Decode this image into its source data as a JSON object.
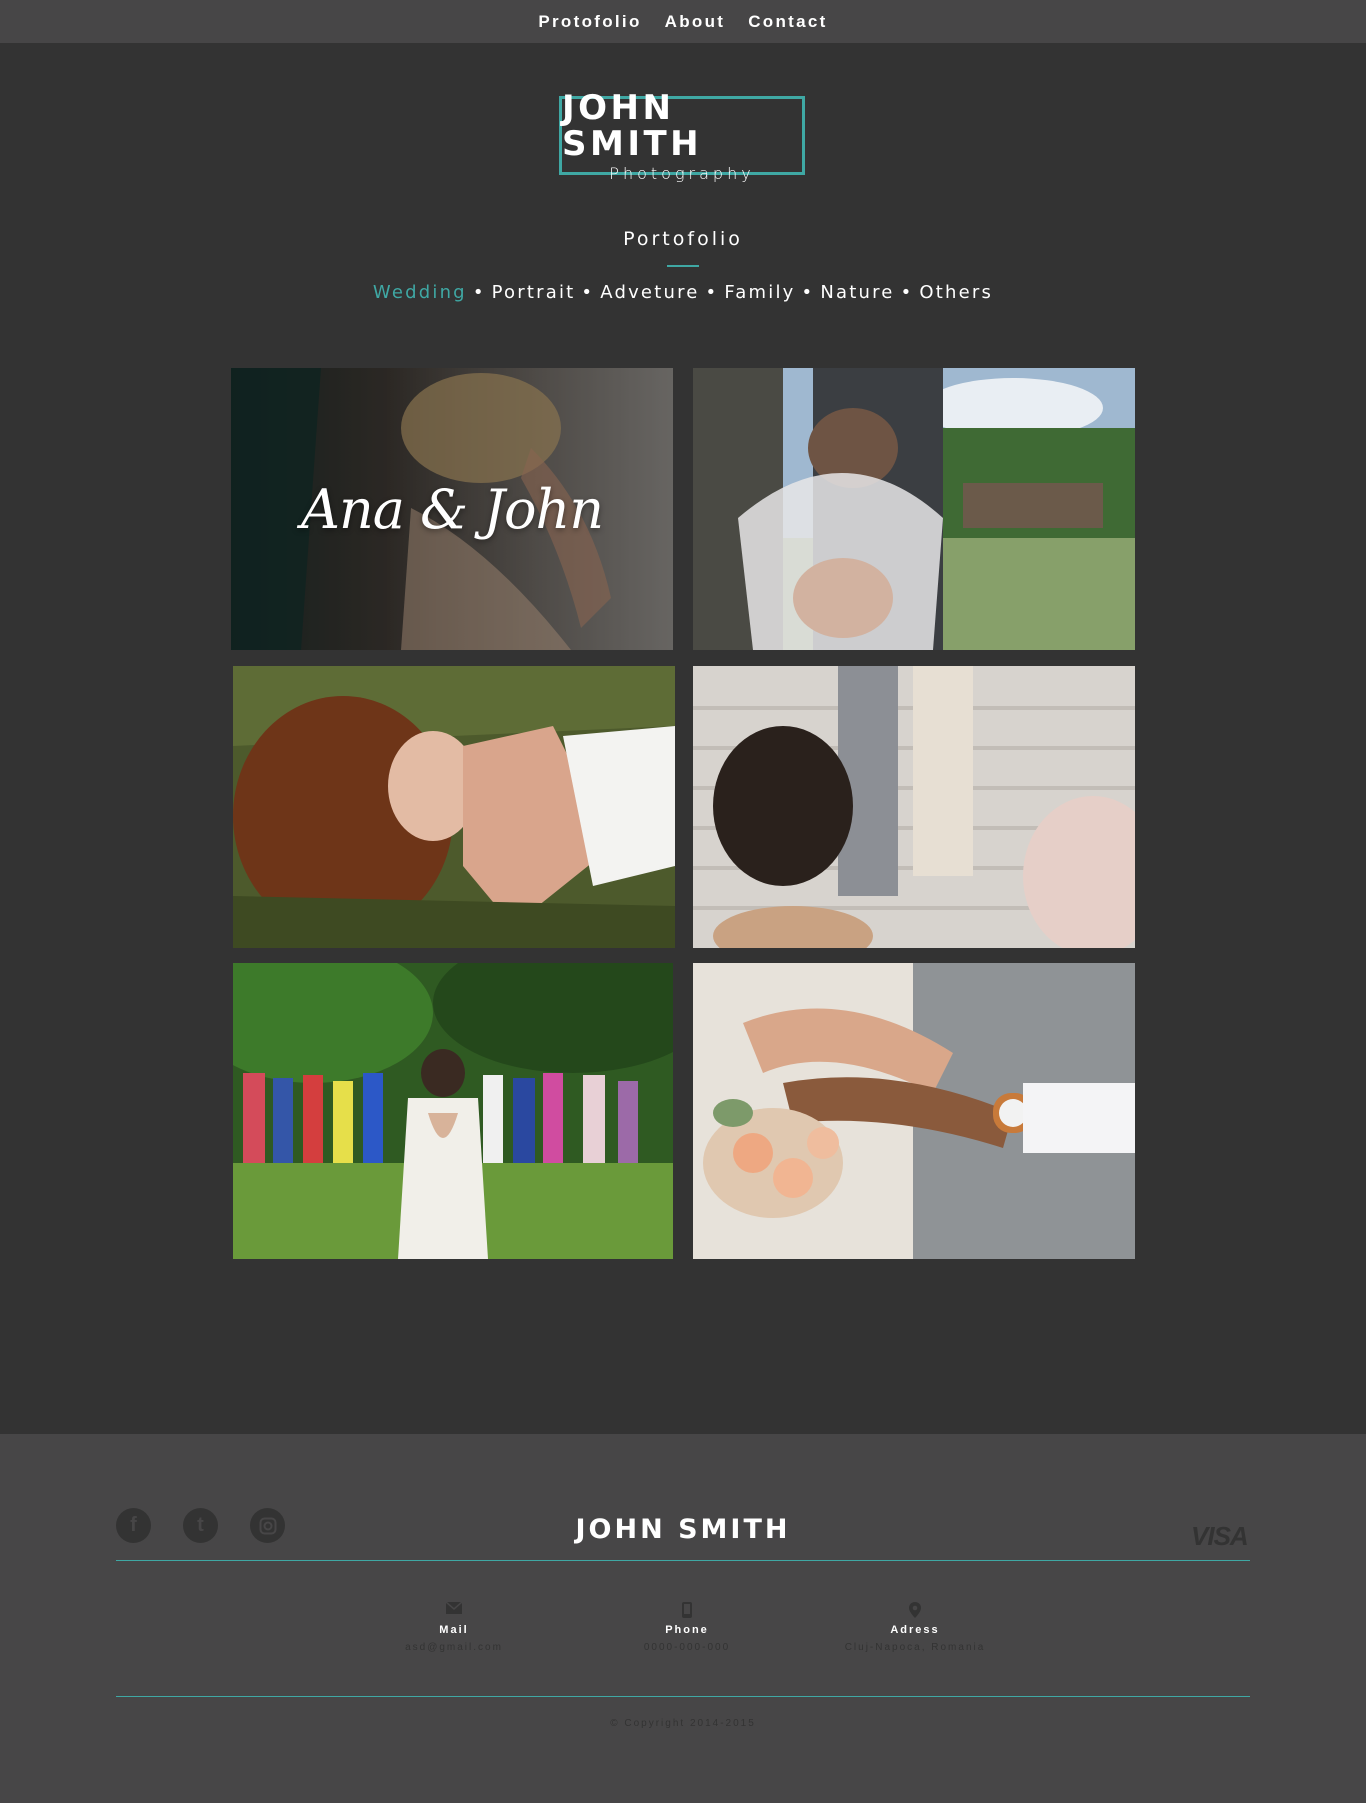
{
  "nav": {
    "items": [
      "Protofolio",
      "About",
      "Contact"
    ]
  },
  "logo": {
    "name": "JOHN SMITH",
    "subtitle": "Photography"
  },
  "section": {
    "title": "Portofolio",
    "filters": [
      "Wedding",
      "Portrait",
      "Adveture",
      "Family",
      "Nature",
      "Others"
    ],
    "active_filter": "Wedding",
    "separator": "•"
  },
  "gallery": {
    "featured_caption": "Ana & John",
    "photos": [
      "bride-getting-ready",
      "couple-embrace-veil",
      "bride-lying-in-grass",
      "couple-walking-stairs-confetti",
      "bride-with-guests-garden",
      "hands-with-rings-bouquet"
    ]
  },
  "footer": {
    "name": "JOHN SMITH",
    "social_icons": [
      "facebook-icon",
      "tumblr-icon",
      "instagram-icon"
    ],
    "payment": "VISA",
    "contacts": [
      {
        "icon": "mail-icon",
        "label": "Mail",
        "value": "asd@gmail.com"
      },
      {
        "icon": "phone-icon",
        "label": "Phone",
        "value": "0000-000-000"
      },
      {
        "icon": "location-icon",
        "label": "Adress",
        "value": "Cluj-Napoca, Romania"
      }
    ],
    "copyright": "© Copyright 2014-2015"
  },
  "colors": {
    "accent": "#3fa8a4",
    "background": "#333333",
    "bar": "#474647"
  }
}
